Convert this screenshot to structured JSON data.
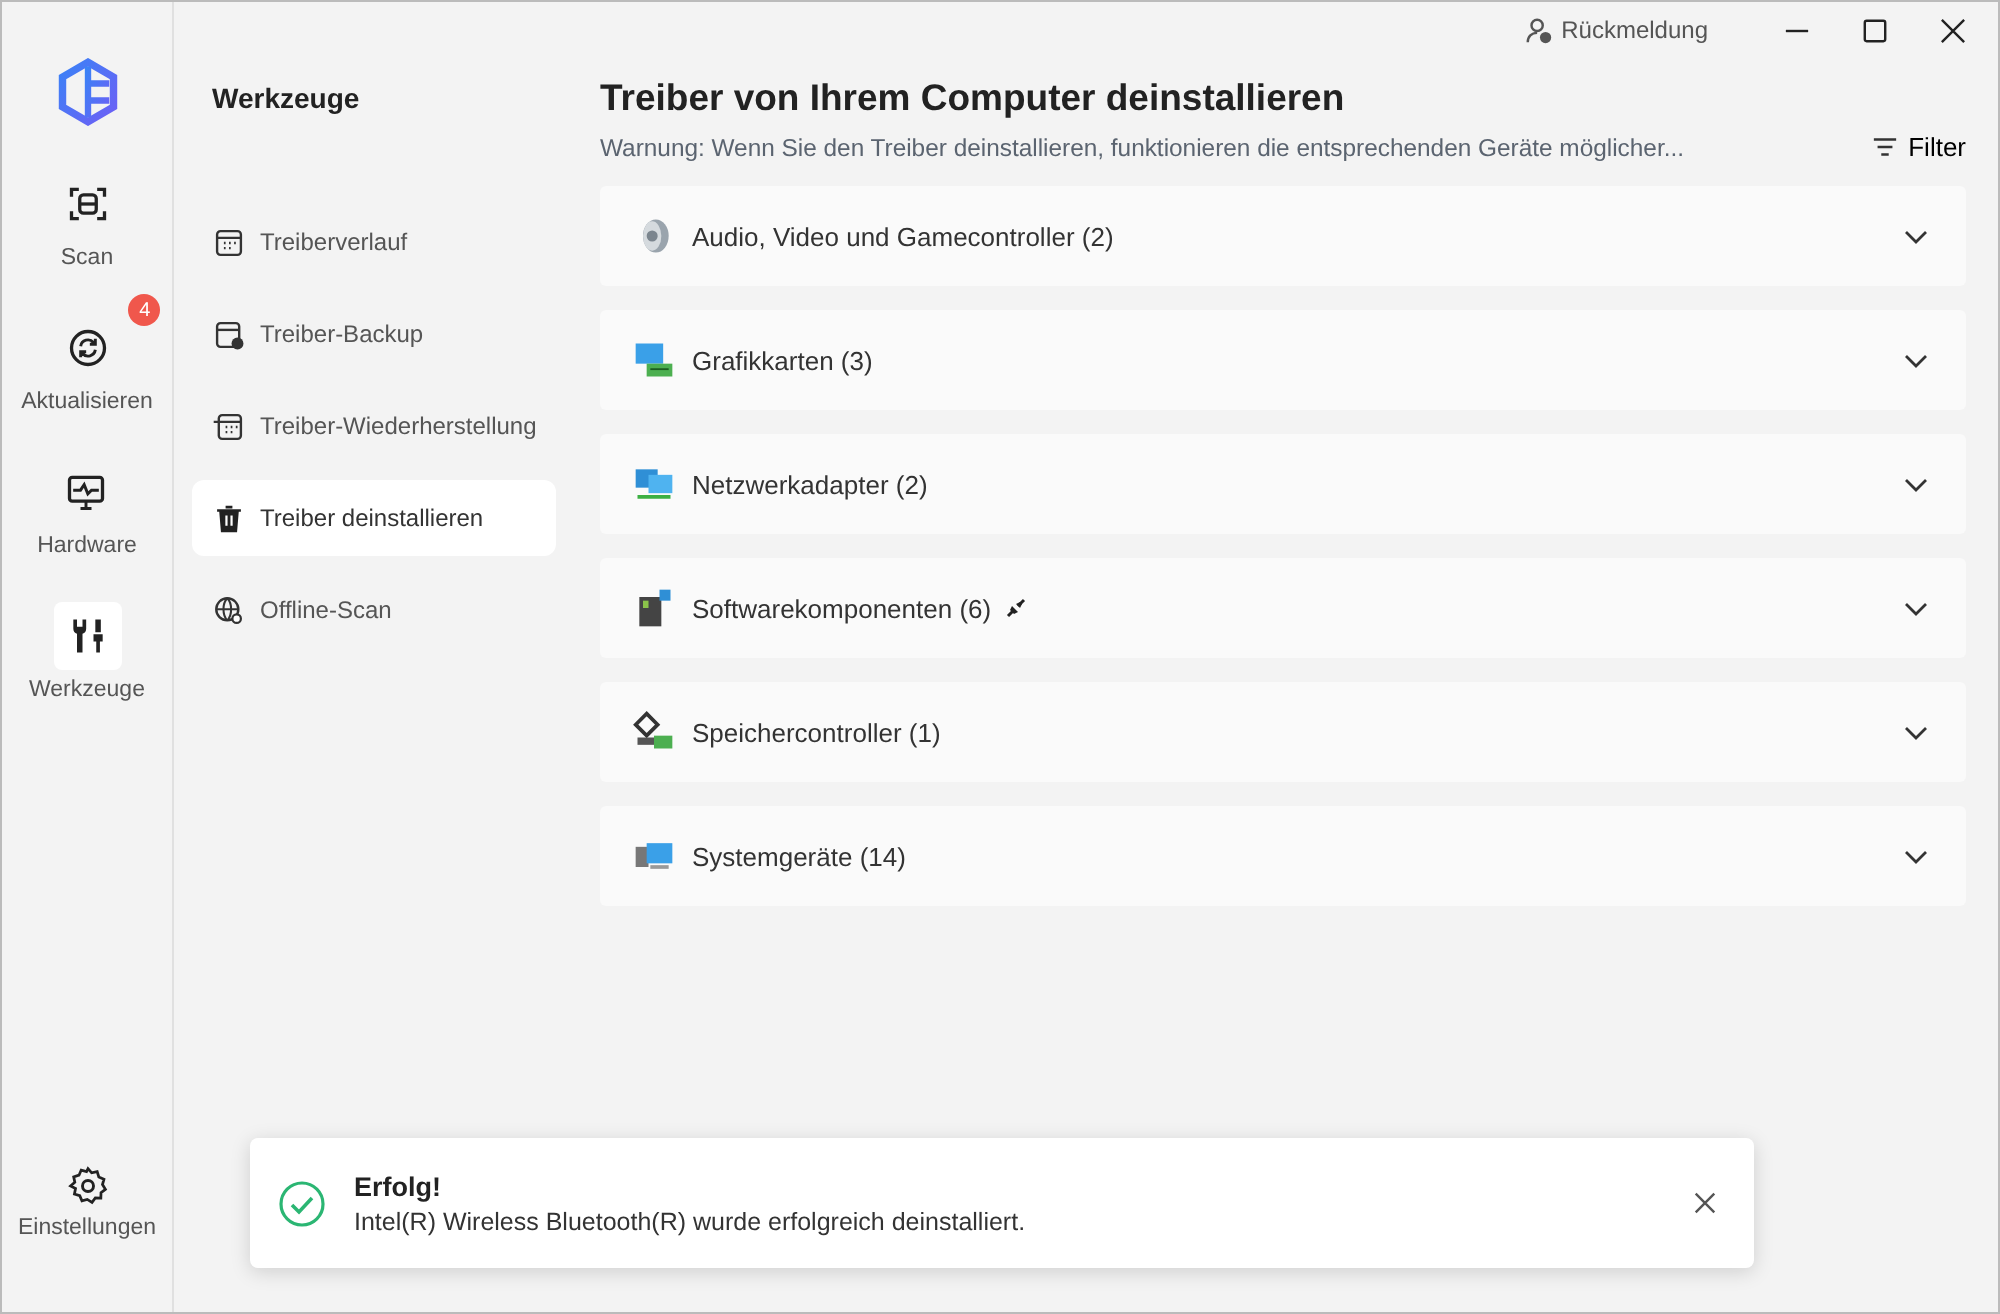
{
  "titlebar": {
    "feedback": "Rückmeldung"
  },
  "rail": {
    "items": [
      {
        "kind": "scan",
        "label": "Scan",
        "selected": false
      },
      {
        "kind": "update",
        "label": "Aktualisieren",
        "selected": false,
        "badge": "4"
      },
      {
        "kind": "hardware",
        "label": "Hardware",
        "selected": false
      },
      {
        "kind": "tools",
        "label": "Werkzeuge",
        "selected": true
      }
    ],
    "settings": {
      "label": "Einstellungen"
    }
  },
  "tools": {
    "title": "Werkzeuge",
    "items": [
      {
        "kind": "history",
        "label": "Treiberverlauf",
        "selected": false
      },
      {
        "kind": "backup",
        "label": "Treiber-Backup",
        "selected": false
      },
      {
        "kind": "restore",
        "label": "Treiber-Wiederherstellung",
        "selected": false
      },
      {
        "kind": "uninstall",
        "label": "Treiber deinstallieren",
        "selected": true
      },
      {
        "kind": "offline",
        "label": "Offline-Scan",
        "selected": false
      }
    ]
  },
  "main": {
    "title": "Treiber von Ihrem Computer deinstallieren",
    "warning": "Warnung: Wenn Sie den Treiber deinstallieren, funktionieren die entsprechenden Geräte möglicher...",
    "filter": "Filter",
    "categories": [
      {
        "kind": "audio",
        "label": "Audio, Video und Gamecontroller (2)",
        "expanded": false,
        "linked": false
      },
      {
        "kind": "display",
        "label": "Grafikkarten (3)",
        "expanded": false,
        "linked": false
      },
      {
        "kind": "network",
        "label": "Netzwerkadapter (2)",
        "expanded": false,
        "linked": false
      },
      {
        "kind": "software",
        "label": "Softwarekomponenten (6)",
        "expanded": false,
        "linked": true
      },
      {
        "kind": "storage",
        "label": "Speichercontroller (1)",
        "expanded": false,
        "linked": false
      },
      {
        "kind": "system",
        "label": "Systemgeräte (14)",
        "expanded": false,
        "linked": false
      }
    ]
  },
  "toast": {
    "title": "Erfolg!",
    "message": "Intel(R) Wireless Bluetooth(R) wurde erfolgreich deinstalliert."
  }
}
